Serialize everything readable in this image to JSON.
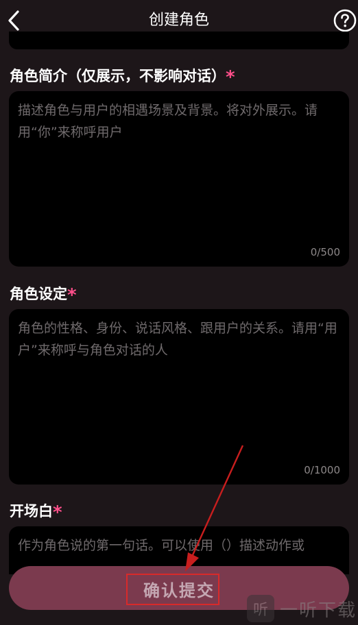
{
  "header": {
    "title": "创建角色",
    "back_icon": "chevron-left-icon",
    "help_icon": "question-circle-icon"
  },
  "sections": {
    "intro": {
      "label": "角色简介（仅展示，不影响对话）",
      "required_mark": "*",
      "placeholder": "描述角色与用户的相遇场景及背景。将对外展示。请用“你”来称呼用户",
      "counter": "0/500"
    },
    "setting": {
      "label": "角色设定",
      "required_mark": "*",
      "placeholder": "角色的性格、身份、说话风格、跟用户的关系。请用“用户”来称呼与角色对话的人",
      "counter": "0/1000"
    },
    "opening": {
      "label": "开场白",
      "required_mark": "*",
      "placeholder": "作为角色说的第一句话。可以使用（）描述动作或"
    }
  },
  "submit": {
    "label": "确认提交"
  },
  "watermark": {
    "logo": "听",
    "text": "一听下载"
  },
  "colors": {
    "background": "#1d1619",
    "field": "#000000",
    "accent_required": "#ff4f8b",
    "submit_bg": "#7b3a4e",
    "annotation": "#d92a2a"
  }
}
